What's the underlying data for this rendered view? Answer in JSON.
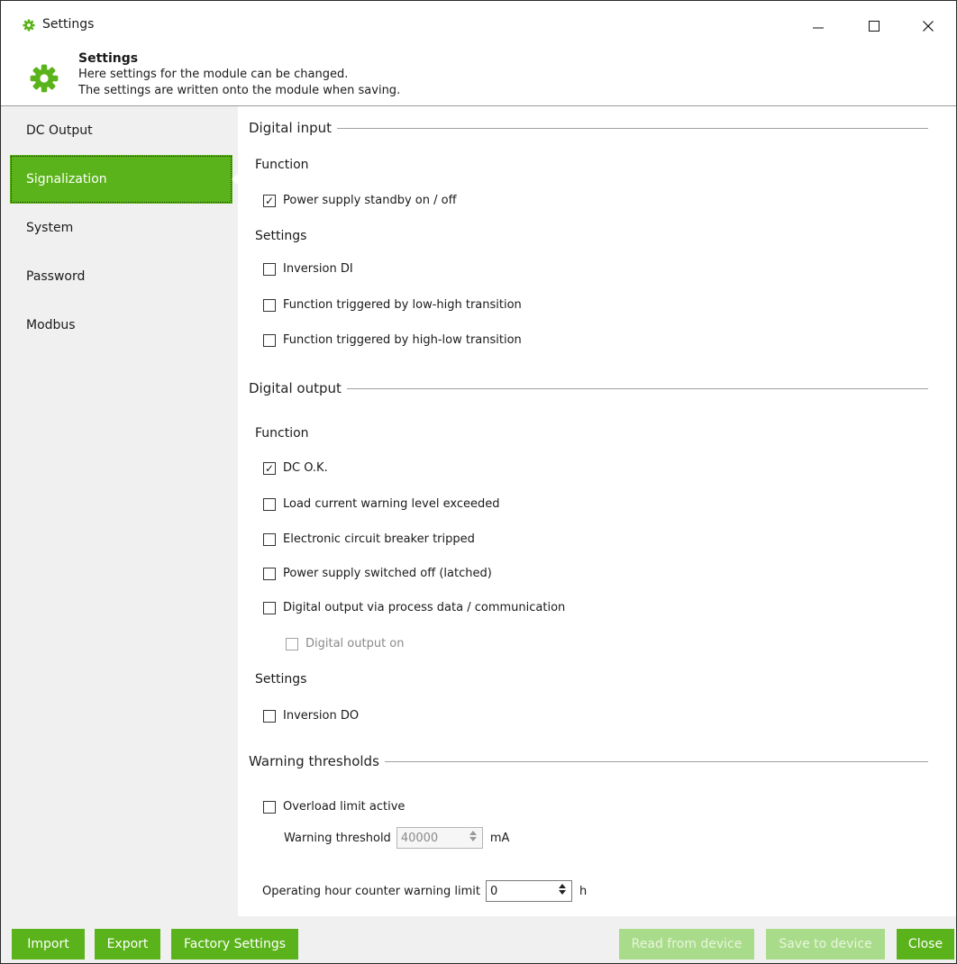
{
  "window": {
    "title": "Settings",
    "controls": {
      "minimize_icon": "minimize-icon",
      "maximize_icon": "maximize-icon",
      "close_icon": "close-icon"
    }
  },
  "header": {
    "title": "Settings",
    "line1": "Here settings for the module can be changed.",
    "line2": "The settings are written onto the module when saving.",
    "icon": "gear-icon"
  },
  "colors": {
    "accent": "#5ab31a",
    "accent_disabled": "#a9dc8a",
    "sidebar_bg": "#f0f0f0"
  },
  "sidebar": {
    "items": [
      {
        "label": "DC Output",
        "selected": false
      },
      {
        "label": "Signalization",
        "selected": true
      },
      {
        "label": "System",
        "selected": false
      },
      {
        "label": "Password",
        "selected": false
      },
      {
        "label": "Modbus",
        "selected": false
      }
    ]
  },
  "digital_input": {
    "title": "Digital input",
    "function_label": "Function",
    "function_items": [
      {
        "label": "Power supply standby on / off",
        "checked": true
      }
    ],
    "settings_label": "Settings",
    "settings_items": [
      {
        "label": "Inversion DI",
        "checked": false
      },
      {
        "label": "Function triggered by low-high transition",
        "checked": false
      },
      {
        "label": "Function triggered by high-low transition",
        "checked": false
      }
    ]
  },
  "digital_output": {
    "title": "Digital output",
    "function_label": "Function",
    "function_items": [
      {
        "label": "DC O.K.",
        "checked": true
      },
      {
        "label": "Load current warning level exceeded",
        "checked": false
      },
      {
        "label": "Electronic circuit breaker tripped",
        "checked": false
      },
      {
        "label": "Power supply switched off (latched)",
        "checked": false
      },
      {
        "label": "Digital output via process data / communication",
        "checked": false
      }
    ],
    "sub_item": {
      "label": "Digital output on",
      "checked": false,
      "disabled": true
    },
    "settings_label": "Settings",
    "settings_items": [
      {
        "label": "Inversion DO",
        "checked": false
      }
    ]
  },
  "warning_thresholds": {
    "title": "Warning thresholds",
    "overload": {
      "label": "Overload limit active",
      "checked": false
    },
    "threshold": {
      "label": "Warning threshold",
      "value": "40000",
      "unit": "mA",
      "disabled": true
    },
    "hour_counter": {
      "label": "Operating hour counter warning limit",
      "value": "0",
      "unit": "h"
    }
  },
  "footer": {
    "import": "Import",
    "export": "Export",
    "factory": "Factory Settings",
    "read": "Read from device",
    "save": "Save to device",
    "close": "Close"
  }
}
